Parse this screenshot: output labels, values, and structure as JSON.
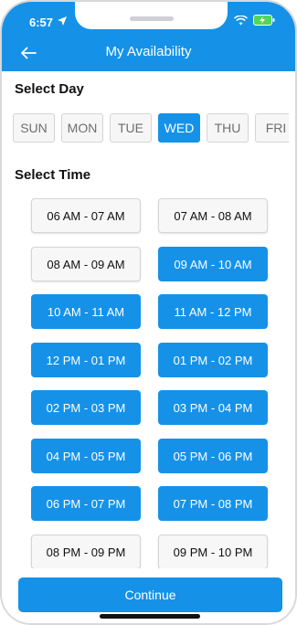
{
  "status_bar": {
    "time": "6:57"
  },
  "header": {
    "title": "My Availability"
  },
  "day_section": {
    "title": "Select Day",
    "days": [
      {
        "label": "SUN",
        "selected": false
      },
      {
        "label": "MON",
        "selected": false
      },
      {
        "label": "TUE",
        "selected": false
      },
      {
        "label": "WED",
        "selected": true
      },
      {
        "label": "THU",
        "selected": false
      },
      {
        "label": "FRI",
        "selected": false
      }
    ]
  },
  "time_section": {
    "title": "Select Time",
    "slots": [
      {
        "label": "06 AM - 07 AM",
        "selected": false
      },
      {
        "label": "07 AM - 08 AM",
        "selected": false
      },
      {
        "label": "08 AM - 09 AM",
        "selected": false
      },
      {
        "label": "09 AM - 10 AM",
        "selected": true
      },
      {
        "label": "10 AM - 11 AM",
        "selected": true
      },
      {
        "label": "11 AM - 12 PM",
        "selected": true
      },
      {
        "label": "12 PM - 01 PM",
        "selected": true
      },
      {
        "label": "01 PM - 02 PM",
        "selected": true
      },
      {
        "label": "02 PM - 03 PM",
        "selected": true
      },
      {
        "label": "03 PM - 04 PM",
        "selected": true
      },
      {
        "label": "04 PM - 05 PM",
        "selected": true
      },
      {
        "label": "05 PM - 06 PM",
        "selected": true
      },
      {
        "label": "06 PM - 07 PM",
        "selected": true
      },
      {
        "label": "07 PM - 08 PM",
        "selected": true
      },
      {
        "label": "08 PM - 09 PM",
        "selected": false
      },
      {
        "label": "09 PM - 10 PM",
        "selected": false
      }
    ]
  },
  "footer": {
    "continue_label": "Continue"
  },
  "colors": {
    "accent": "#1592e8",
    "unselected_bg": "#f7f7f7",
    "unselected_border": "#d5d5d5"
  },
  "icons": {
    "back": "arrow-left-icon",
    "location": "location-arrow-icon",
    "wifi": "wifi-icon",
    "battery": "battery-charging-icon"
  }
}
